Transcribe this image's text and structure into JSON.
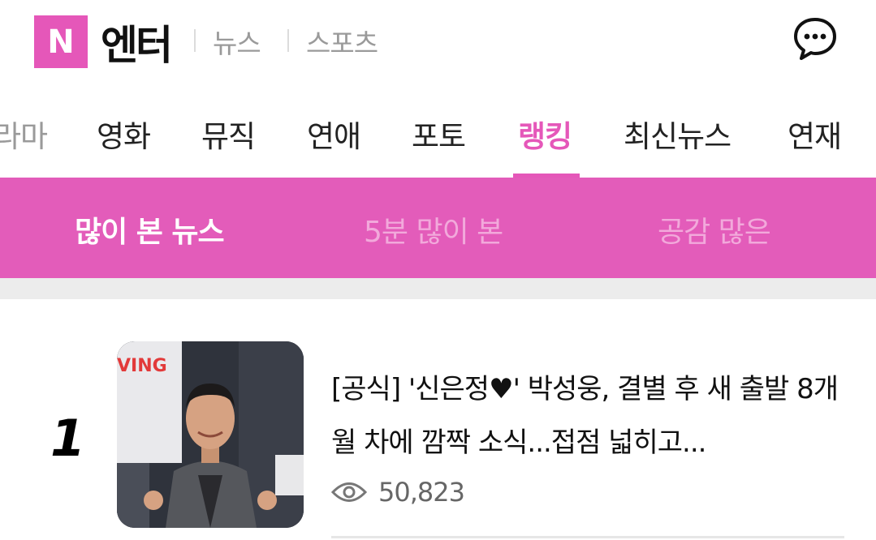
{
  "header": {
    "logo_letter": "N",
    "title": "엔터",
    "links": [
      "뉴스",
      "스포츠"
    ]
  },
  "nav": {
    "items": [
      {
        "label": "라마"
      },
      {
        "label": "영화"
      },
      {
        "label": "뮤직"
      },
      {
        "label": "연애"
      },
      {
        "label": "포토"
      },
      {
        "label": "랭킹"
      },
      {
        "label": "최신뉴스"
      },
      {
        "label": "연재"
      }
    ],
    "active": "랭킹"
  },
  "ranking_tabs": {
    "items": [
      "많이 본 뉴스",
      "5분 많이 본",
      "공감 많은"
    ],
    "selected": "많이 본 뉴스"
  },
  "articles": [
    {
      "rank": "1",
      "headline": "[공식] '신은정♥' 박성웅, 결별 후 새 출발 8개월 차에 깜짝 소식...접점 넓히고...",
      "views": "50,823",
      "thumb_text": "VING"
    }
  ],
  "colors": {
    "accent": "#e557b9",
    "tab_bar": "#e35cba"
  },
  "icons": {
    "chat": "chat-bubble-icon",
    "views": "eye-icon"
  }
}
